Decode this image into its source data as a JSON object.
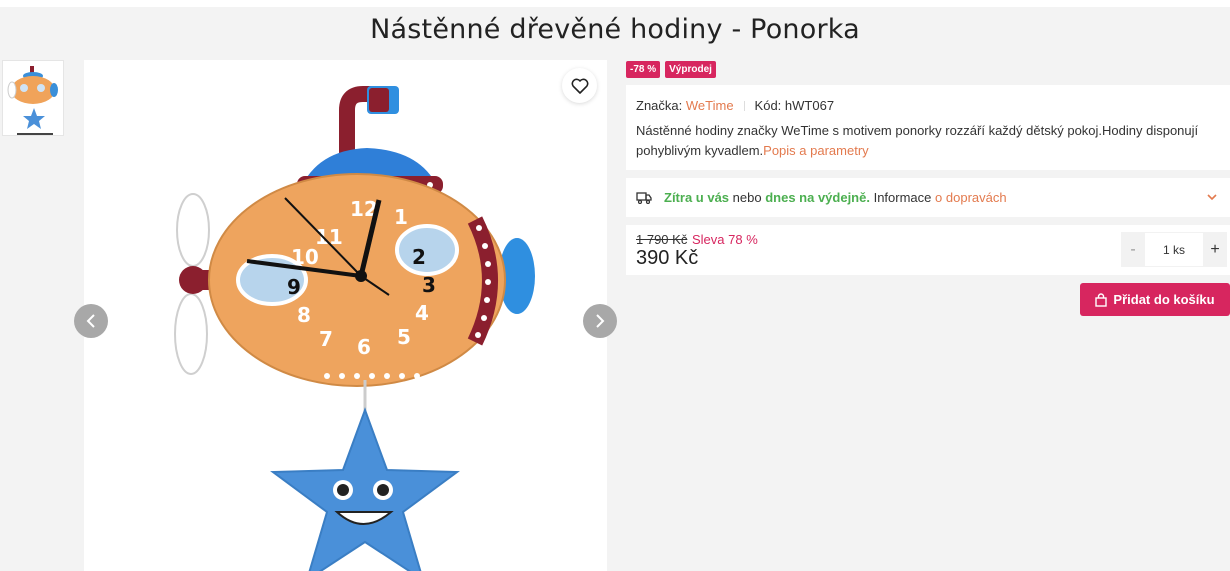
{
  "product": {
    "title": "Nástěnné dřevěné hodiny - Ponorka"
  },
  "badges": {
    "discount": "-78 %",
    "sale": "Výprodej"
  },
  "info": {
    "brand_label": "Značka:",
    "brand_value": "WeTime",
    "code_label": "Kód:",
    "code_value": "hWT067",
    "description": "Nástěnné hodiny značky WeTime s motivem ponorky rozzáří každý dětský pokoj.Hodiny disponují pohyblivým kyvadlem.",
    "description_link": "Popis a parametry"
  },
  "delivery": {
    "tomorrow": "Zítra u vás",
    "or": "nebo",
    "today": "dnes na výdejně.",
    "info": "Informace",
    "link": "o dopravách"
  },
  "pricing": {
    "old_price": "1 790 Kč",
    "discount_text": "Sleva 78 %",
    "price": "390 Kč"
  },
  "quantity": {
    "minus": "-",
    "value": "1 ks",
    "plus": "+"
  },
  "cart": {
    "label": "Přidat do košíku"
  },
  "clock": {
    "numbers": [
      "12",
      "1",
      "2",
      "3",
      "4",
      "5",
      "6",
      "7",
      "8",
      "9",
      "10",
      "11"
    ]
  },
  "icons": {
    "favorite": "heart-icon",
    "prev": "chevron-left-icon",
    "next": "chevron-right-icon",
    "delivery": "truck-icon",
    "expand": "chevron-down-icon",
    "cart": "bag-icon"
  },
  "colors": {
    "accent": "#e37a4e",
    "brand_pink": "#d7265f",
    "green": "#4caf50"
  }
}
